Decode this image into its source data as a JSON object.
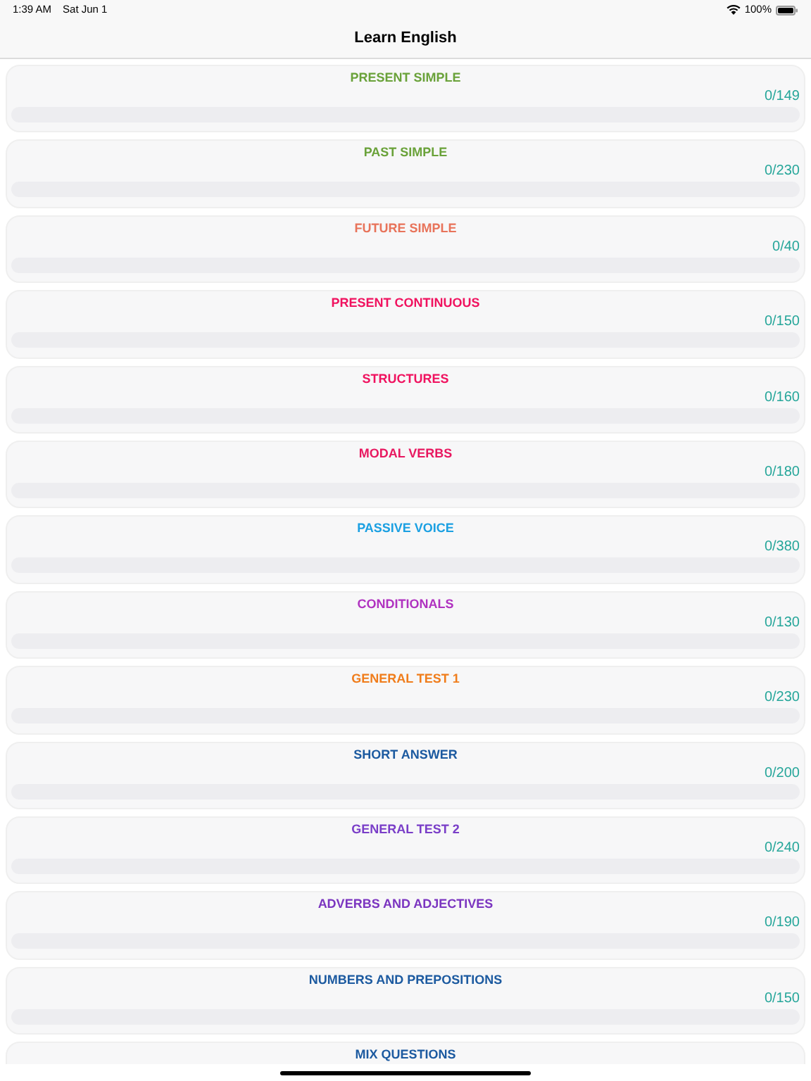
{
  "status_bar": {
    "time": "1:39 AM",
    "date": "Sat Jun 1",
    "battery": "100%"
  },
  "nav": {
    "title": "Learn English"
  },
  "lessons": [
    {
      "title": "PRESENT SIMPLE",
      "color": "#6aa23a",
      "count": "0/149"
    },
    {
      "title": "PAST SIMPLE",
      "color": "#6aa23a",
      "count": "0/230"
    },
    {
      "title": "FUTURE SIMPLE",
      "color": "#e8735a",
      "count": "0/40"
    },
    {
      "title": "PRESENT CONTINUOUS",
      "color": "#f0125f",
      "count": "0/150"
    },
    {
      "title": "STRUCTURES",
      "color": "#f0125f",
      "count": "0/160"
    },
    {
      "title": "MODAL VERBS",
      "color": "#e81860",
      "count": "0/180"
    },
    {
      "title": "PASSIVE VOICE",
      "color": "#1ba0e2",
      "count": "0/380"
    },
    {
      "title": "CONDITIONALS",
      "color": "#b032c0",
      "count": "0/130"
    },
    {
      "title": "GENERAL TEST 1",
      "color": "#f07d1c",
      "count": "0/230"
    },
    {
      "title": "SHORT ANSWER",
      "color": "#1c5aa0",
      "count": "0/200"
    },
    {
      "title": "GENERAL TEST 2",
      "color": "#7a3ec8",
      "count": "0/240"
    },
    {
      "title": "ADVERBS AND ADJECTIVES",
      "color": "#7b35c0",
      "count": "0/190"
    },
    {
      "title": "NUMBERS AND PREPOSITIONS",
      "color": "#1c5aa0",
      "count": "0/150"
    },
    {
      "title": "MIX QUESTIONS",
      "color": "#1c5aa0"
    }
  ]
}
